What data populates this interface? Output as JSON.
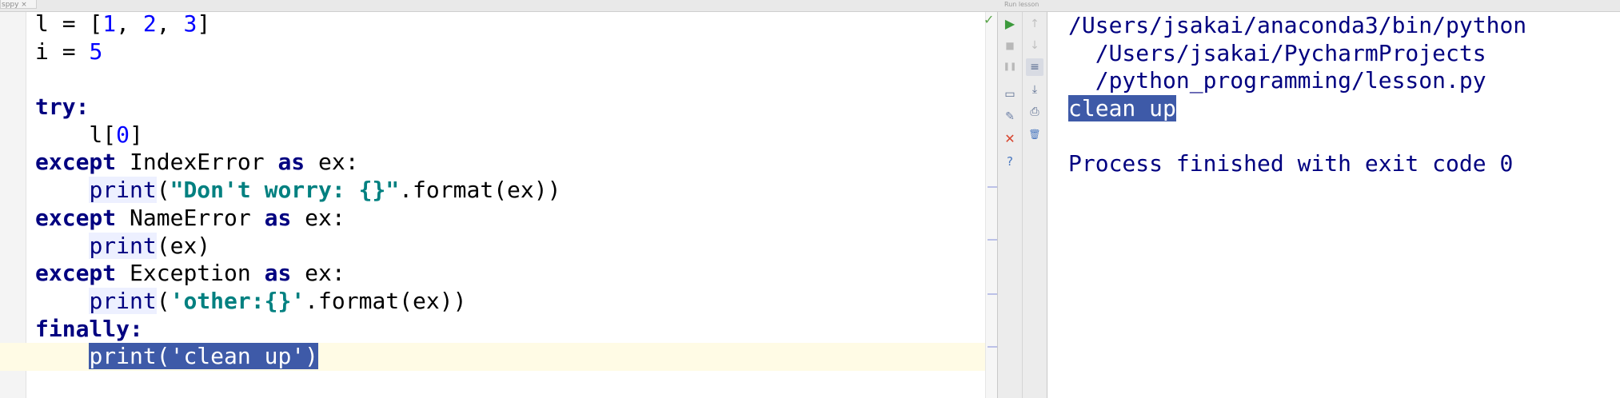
{
  "window": {
    "tab_label": "sppy ×",
    "run_label": "Run  lesson"
  },
  "editor": {
    "lines": [
      [
        {
          "t": "l = [",
          "c": ""
        },
        {
          "t": "1",
          "c": "num"
        },
        {
          "t": ", ",
          "c": ""
        },
        {
          "t": "2",
          "c": "num"
        },
        {
          "t": ", ",
          "c": ""
        },
        {
          "t": "3",
          "c": "num"
        },
        {
          "t": "]",
          "c": ""
        }
      ],
      [
        {
          "t": "i = ",
          "c": ""
        },
        {
          "t": "5",
          "c": "num"
        }
      ],
      [],
      [
        {
          "t": "try",
          "c": "kw"
        },
        {
          "t": ":",
          "c": "kw"
        }
      ],
      [
        {
          "t": "    l[",
          "c": ""
        },
        {
          "t": "0",
          "c": "num"
        },
        {
          "t": "]",
          "c": ""
        }
      ],
      [
        {
          "t": "except",
          "c": "kw"
        },
        {
          "t": " IndexError ",
          "c": ""
        },
        {
          "t": "as",
          "c": "kw"
        },
        {
          "t": " ex:",
          "c": ""
        }
      ],
      [
        {
          "t": "    ",
          "c": ""
        },
        {
          "t": "print",
          "c": "builtin"
        },
        {
          "t": "(",
          "c": ""
        },
        {
          "t": "\"Don't worry: {}\"",
          "c": "str"
        },
        {
          "t": ".format(ex))",
          "c": ""
        }
      ],
      [
        {
          "t": "except",
          "c": "kw"
        },
        {
          "t": " NameError ",
          "c": ""
        },
        {
          "t": "as",
          "c": "kw"
        },
        {
          "t": " ex:",
          "c": ""
        }
      ],
      [
        {
          "t": "    ",
          "c": ""
        },
        {
          "t": "print",
          "c": "builtin"
        },
        {
          "t": "(ex)",
          "c": ""
        }
      ],
      [
        {
          "t": "except",
          "c": "kw"
        },
        {
          "t": " Exception ",
          "c": ""
        },
        {
          "t": "as",
          "c": "kw"
        },
        {
          "t": " ex:",
          "c": ""
        }
      ],
      [
        {
          "t": "    ",
          "c": ""
        },
        {
          "t": "print",
          "c": "builtin"
        },
        {
          "t": "(",
          "c": ""
        },
        {
          "t": "'other:{}'",
          "c": "str"
        },
        {
          "t": ".format(ex))",
          "c": ""
        }
      ],
      [
        {
          "t": "finally",
          "c": "kw"
        },
        {
          "t": ":",
          "c": "kw"
        }
      ],
      [
        {
          "t": "    ",
          "c": ""
        },
        {
          "t": "print('clean up')",
          "c": "selected"
        }
      ]
    ],
    "current_line": 12
  },
  "toolbar": {
    "rerun": "▶",
    "stop": "■",
    "pause": "❚❚",
    "dump": "▭",
    "pin": "✎",
    "close": "✕",
    "help": "?",
    "up": "↑",
    "down": "↓",
    "soft_wrap": "≡",
    "scroll_end": "⤓",
    "print": "⎙",
    "clear": "🗑"
  },
  "console": {
    "lines": [
      {
        "text": "/Users/jsakai/anaconda3/bin/python",
        "selected": false
      },
      {
        "text": "  /Users/jsakai/PycharmProjects",
        "selected": false
      },
      {
        "text": "  /python_programming/lesson.py",
        "selected": false
      },
      {
        "text": "clean up",
        "selected": true
      },
      {
        "text": "",
        "selected": false
      },
      {
        "text": "Process finished with exit code 0",
        "selected": false
      }
    ]
  },
  "colors": {
    "keyword": "#000080",
    "string": "#008080",
    "number": "#0000ff",
    "selection": "#3e5aa8",
    "run_green": "#3c9a3c",
    "close_red": "#d8452e"
  }
}
